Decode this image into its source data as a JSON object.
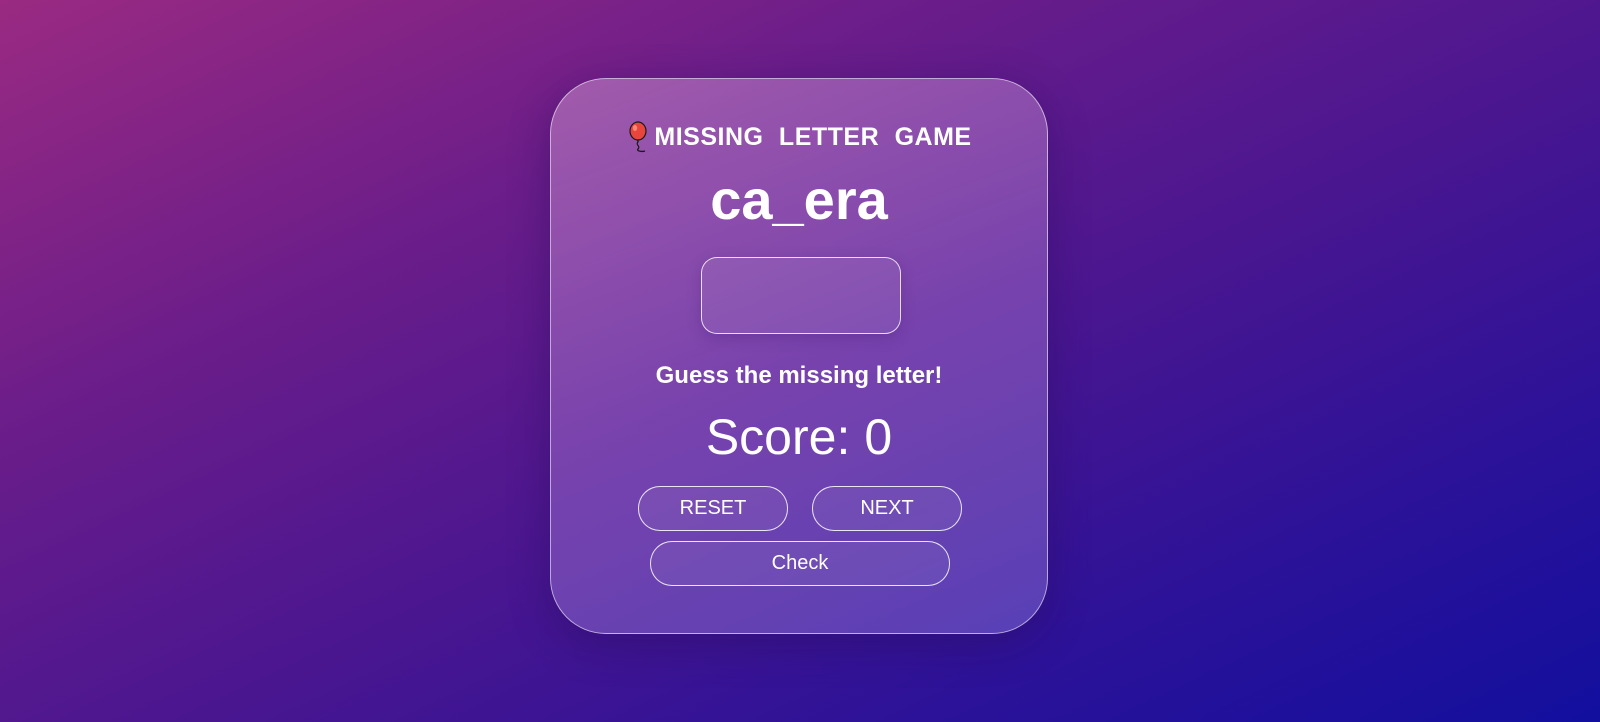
{
  "game": {
    "title": "MISSING LETTER GAME",
    "title_icon": "balloon-icon",
    "puzzle_word": "ca_era",
    "answer_input": {
      "value": "",
      "placeholder": ""
    },
    "message": "Guess the missing letter!",
    "score_label": "Score:",
    "score_value": "0"
  },
  "buttons": {
    "reset": "RESET",
    "next": "NEXT",
    "check": "Check"
  },
  "colors": {
    "background_start": "#9a2a82",
    "background_end": "#120f9e",
    "text": "#ffffff",
    "balloon": "#e8453c"
  }
}
